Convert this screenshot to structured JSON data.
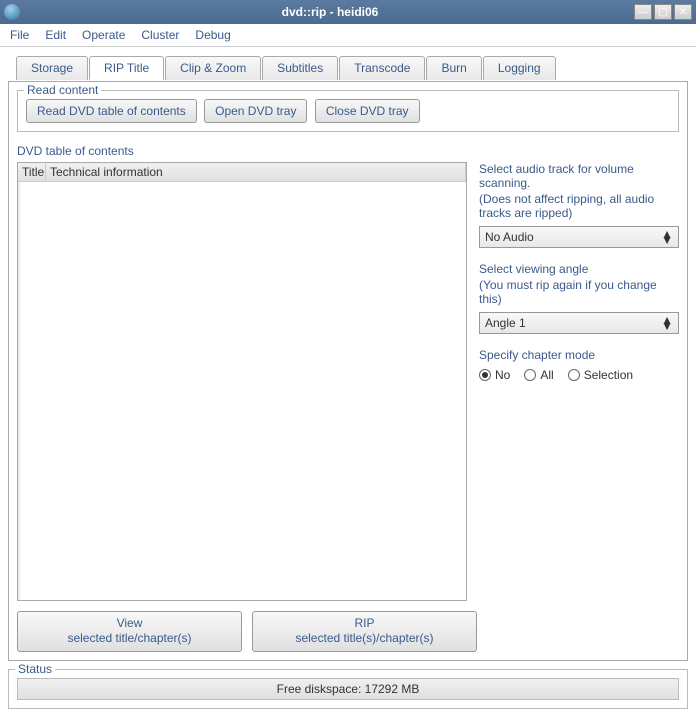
{
  "window": {
    "title": "dvd::rip - heidi06"
  },
  "menubar": {
    "file": "File",
    "edit": "Edit",
    "operate": "Operate",
    "cluster": "Cluster",
    "debug": "Debug"
  },
  "tabs": {
    "storage": "Storage",
    "rip_title": "RIP Title",
    "clip_zoom": "Clip & Zoom",
    "subtitles": "Subtitles",
    "transcode": "Transcode",
    "burn": "Burn",
    "logging": "Logging"
  },
  "read_content": {
    "legend": "Read content",
    "read_toc": "Read DVD table of contents",
    "open_tray": "Open DVD tray",
    "close_tray": "Close DVD tray"
  },
  "toc": {
    "label": "DVD table of contents",
    "col_title": "Title",
    "col_tech": "Technical information"
  },
  "side": {
    "audio_label": "Select audio track for volume scanning.",
    "audio_note": "(Does not affect ripping, all audio tracks are ripped)",
    "audio_value": "No Audio",
    "angle_label": "Select viewing angle",
    "angle_note": "(You must rip again if you change this)",
    "angle_value": "Angle 1",
    "chapter_label": "Specify chapter mode",
    "chapter_no": "No",
    "chapter_all": "All",
    "chapter_selection": "Selection"
  },
  "bottom": {
    "view_line1": "View",
    "view_line2": "selected title/chapter(s)",
    "rip_line1": "RIP",
    "rip_line2": "selected title(s)/chapter(s)"
  },
  "status": {
    "legend": "Status",
    "text": "Free diskspace: 17292 MB"
  }
}
